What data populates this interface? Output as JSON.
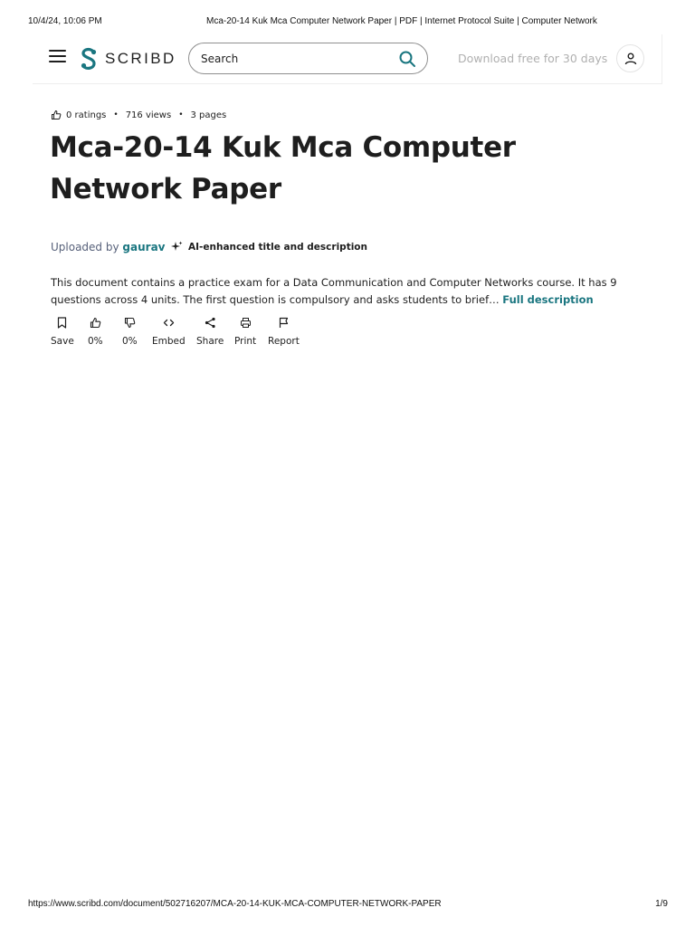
{
  "print_header": {
    "datetime": "10/4/24, 10:06 PM",
    "page_title": "Mca-20-14 Kuk Mca Computer Network Paper | PDF | Internet Protocol Suite | Computer Network"
  },
  "topbar": {
    "logo_text": "SCRIBD",
    "search_placeholder": "Search",
    "download_label": "Download free for 30 days"
  },
  "document": {
    "ratings": "0 ratings",
    "views": "716 views",
    "pages": "3 pages",
    "title": "Mca-20-14 Kuk Mca Computer Network Paper",
    "uploaded_by_label": "Uploaded by",
    "uploader": "gaurav",
    "ai_badge": "AI-enhanced title and description",
    "description": "This document contains a practice exam for a Data Communication and Computer Networks course. It has 9 questions across 4 units. The first question is compulsory and asks students to brief… ",
    "full_description_label": "Full description"
  },
  "actions": [
    {
      "icon": "bookmark-icon",
      "label": "Save"
    },
    {
      "icon": "thumbs-up-icon",
      "label": "0%"
    },
    {
      "icon": "thumbs-down-icon",
      "label": "0%"
    },
    {
      "icon": "embed-icon",
      "label": "Embed"
    },
    {
      "icon": "share-icon",
      "label": "Share"
    },
    {
      "icon": "print-icon",
      "label": "Print"
    },
    {
      "icon": "flag-icon",
      "label": "Report"
    }
  ],
  "print_footer": {
    "url": "https://www.scribd.com/document/502716207/MCA-20-14-KUK-MCA-COMPUTER-NETWORK-PAPER",
    "page_number": "1/9"
  },
  "colors": {
    "brand_teal": "#1a7680",
    "text": "#1e1e1e",
    "muted": "#57617a"
  }
}
